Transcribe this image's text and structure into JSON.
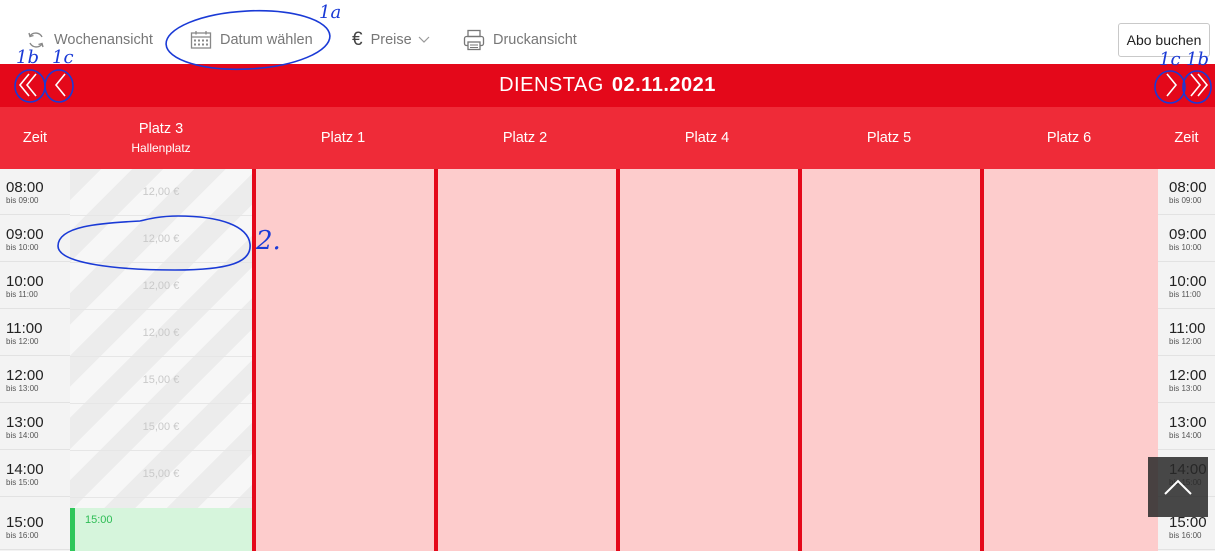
{
  "toolbar": {
    "week_view": "Wochenansicht",
    "choose_date": "Datum wählen",
    "prices": "Preise",
    "prices_symbol": "€",
    "print_view": "Druckansicht",
    "subscription_button": "Abo buchen"
  },
  "datebar": {
    "weekday": "DIENSTAG",
    "date": "02.11.2021"
  },
  "columns": {
    "time_left": "Zeit",
    "time_right": "Zeit",
    "hall_court": {
      "label": "Platz 3",
      "sub": "Hallenplatz"
    },
    "courts": [
      "Platz 1",
      "Platz 2",
      "Platz 4",
      "Platz 5",
      "Platz 6"
    ]
  },
  "slots": [
    {
      "time": "08:00",
      "until": "bis 09:00",
      "price": "12,00 €"
    },
    {
      "time": "09:00",
      "until": "bis 10:00",
      "price": "12,00 €"
    },
    {
      "time": "10:00",
      "until": "bis 11:00",
      "price": "12,00 €"
    },
    {
      "time": "11:00",
      "until": "bis 12:00",
      "price": "12,00 €"
    },
    {
      "time": "12:00",
      "until": "bis 13:00",
      "price": "15,00 €"
    },
    {
      "time": "13:00",
      "until": "bis 14:00",
      "price": "15,00 €"
    },
    {
      "time": "14:00",
      "until": "bis 15:00",
      "price": "15,00 €"
    },
    {
      "time": "15:00",
      "until": "bis 16:00",
      "price": ""
    }
  ],
  "booking": {
    "time": "15:00"
  },
  "annotations": {
    "a1a": "1a",
    "a1b_left": "1b",
    "a1c_left": "1c",
    "a1c_right": "1c",
    "a1b_right": "1b",
    "a2": "2."
  },
  "colors": {
    "primary_red": "#e4081a",
    "header_red": "#ef2b38",
    "court_pink": "#fdcccc",
    "booking_green": "#2ec75a",
    "annotation_blue": "#1a3ad6"
  }
}
